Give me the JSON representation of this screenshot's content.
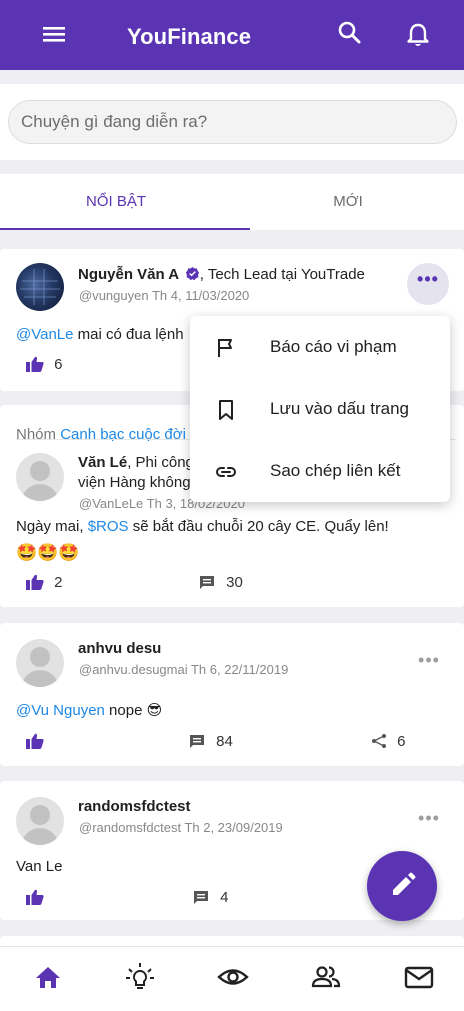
{
  "app": {
    "title": "YouFinance",
    "accent_color": "#5b34b4",
    "link_color": "#1e88e5"
  },
  "topbar": {
    "menu_icon": "menu-icon",
    "search_icon": "search-icon",
    "bell_icon": "bell-icon"
  },
  "composer": {
    "placeholder": "Chuyện gì đang diễn ra?"
  },
  "tabs": [
    {
      "label": "NỔI BẬT",
      "active": true
    },
    {
      "label": "MỚI",
      "active": false
    }
  ],
  "posts": [
    {
      "author": "Nguyễn Văn A",
      "verified": true,
      "role": ", Tech Lead tại YouTrade",
      "handle": "@vunguyen Th 4, 11/03/2020",
      "mention": "@VanLe",
      "text": " mai có đua lệnh",
      "likes": "6"
    },
    {
      "group_prefix": "Nhóm ",
      "group_name": "Canh bạc cuộc đời",
      "author": "Văn Lé",
      "role_line1": ", Phi công",
      "role_line2": "viện Hàng không",
      "handle": "@VanLeLe Th 3, 18/02/2020",
      "text_before": "Ngày mai, ",
      "ticker": "$ROS",
      "text_after": " sẽ bắt đầu chuỗi 20 cây CE. Quẩy lên!",
      "emojis": "🤩🤩🤩",
      "likes": "2",
      "comments": "30"
    },
    {
      "author": "anhvu desu",
      "handle": "@anhvu.desugmai Th 6, 22/11/2019",
      "mention": "@Vu Nguyen",
      "text": "  nope 😎",
      "comments": "84",
      "shares": "6"
    },
    {
      "author": "randomsfdctest",
      "handle": "@randomsfdctest Th 2, 23/09/2019",
      "text": "Van Le",
      "comments": "4"
    }
  ],
  "context_menu": {
    "items": [
      {
        "label": "Báo cáo vi phạm",
        "icon": "flag-icon"
      },
      {
        "label": "Lưu vào dấu trang",
        "icon": "bookmark-icon"
      },
      {
        "label": "Sao chép liên kết",
        "icon": "link-icon"
      }
    ]
  },
  "fab": {
    "icon": "pencil-icon"
  },
  "bottom_nav": [
    {
      "icon": "home-icon",
      "active": true
    },
    {
      "icon": "lightbulb-icon"
    },
    {
      "icon": "eye-icon"
    },
    {
      "icon": "people-icon"
    },
    {
      "icon": "mail-icon"
    }
  ]
}
